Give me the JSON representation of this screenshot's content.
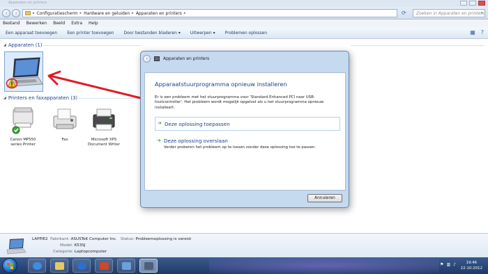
{
  "window": {
    "title": "Apparaten en printers"
  },
  "address": {
    "crumbs": [
      "Configuratiescherm",
      "Hardware en geluiden",
      "Apparaten en printers"
    ],
    "search_placeholder": "Zoeken in Apparaten en printers"
  },
  "menu": [
    "Bestand",
    "Bewerken",
    "Beeld",
    "Extra",
    "Help"
  ],
  "commands": [
    "Een apparaat toevoegen",
    "Een printer toevoegen",
    "Door bestanden bladeren ▾",
    "Uitwerpen ▾",
    "Problemen oplossen"
  ],
  "groups": {
    "devices": {
      "title": "Apparaten (1)"
    },
    "printers": {
      "title": "Printers en faxapparaten (3)",
      "items": [
        {
          "line1": "Canon MP550",
          "line2": "series Printer"
        },
        {
          "line1": "Fax",
          "line2": ""
        },
        {
          "line1": "Microsoft XPS",
          "line2": "Document Writer"
        }
      ]
    }
  },
  "dialog": {
    "title": "Apparaten en printers",
    "heading": "Apparaatstuurprogramma opnieuw installeren",
    "description": "Er is een probleem met het stuurprogramma voor 'Standard Enhanced PCI naar USB-hostcontroller'. Het probleem wordt mogelijk opgelost als u het stuurprogramma opnieuw installeert.",
    "option1": "Deze oplossing toepassen",
    "option2": "Deze oplossing overslaan",
    "option2_sub": "Verder proberen het probleem op te lossen zonder deze oplossing toe te passen.",
    "cancel": "Annuleren"
  },
  "details": {
    "name": "LAPPIE2",
    "manufacturer_label": "Fabrikant:",
    "manufacturer": "ASUSTeK Computer Inc.",
    "status_label": "Status:",
    "status": "Probleemoplossing is vereist",
    "model_label": "Model:",
    "model": "K53SJ",
    "category_label": "Categorie:",
    "category": "Laptopcomputer"
  },
  "taskbar": {
    "time": "19:46",
    "date": "22-10-2012"
  },
  "colors": {
    "accent": "#1e3f8c",
    "arrow": "#e01b24",
    "selection": "#dcebfb"
  }
}
